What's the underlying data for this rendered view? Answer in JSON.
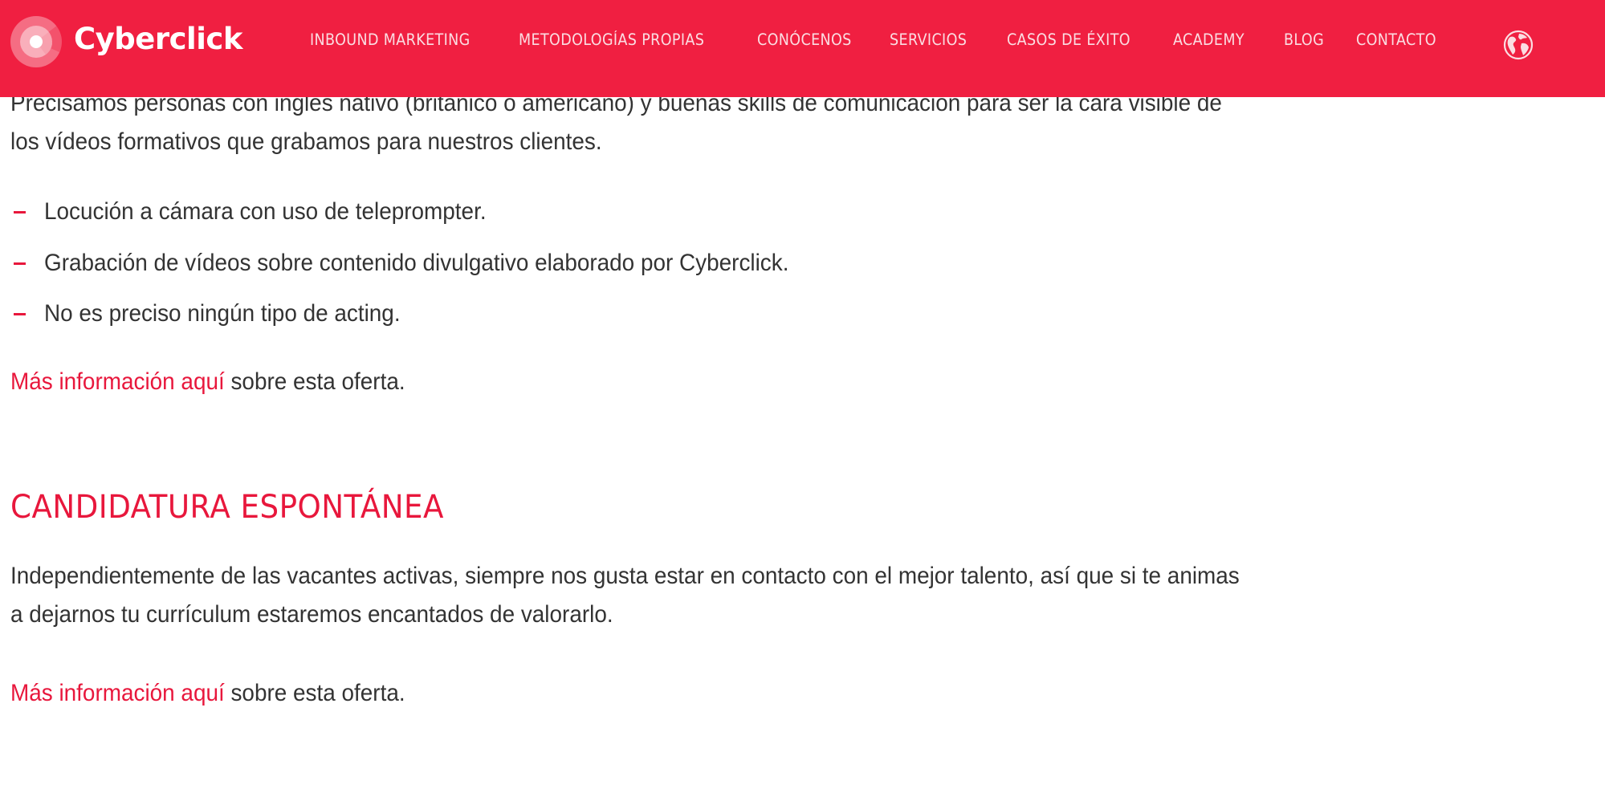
{
  "header": {
    "brand": "Cyberclick",
    "nav": [
      {
        "label": "INBOUND MARKETING"
      },
      {
        "label": "METODOLOGÍAS PROPIAS"
      },
      {
        "label": "CONÓCENOS"
      },
      {
        "label": "SERVICIOS"
      },
      {
        "label": "CASOS DE ÉXITO"
      },
      {
        "label": "ACADEMY"
      },
      {
        "label": "BLOG"
      },
      {
        "label": "CONTACTO"
      }
    ],
    "language_icon": "globe-icon"
  },
  "job_offer": {
    "description_lines": [
      "Precisamos personas con inglés nativo (británico o americano) y buenas skills de comunicación para ser la cara visible de",
      "los vídeos formativos que grabamos para nuestros clientes."
    ],
    "bullets": [
      "Locución a cámara con uso de teleprompter.",
      "Grabación de vídeos sobre contenido divulgativo elaborado por Cyberclick.",
      "No es preciso ningún tipo de acting."
    ],
    "more_info_link": "Más información aquí",
    "more_info_suffix": " sobre esta oferta."
  },
  "spontaneous": {
    "title": "CANDIDATURA ESPONTÁNEA",
    "description_lines": [
      "Independientemente de las vacantes activas, siempre nos gusta estar en contacto con el mejor talento, así que si te animas",
      "a dejarnos tu currículum estaremos encantados de valorarlo."
    ],
    "more_info_link": "Más información aquí",
    "more_info_suffix": " sobre esta oferta."
  },
  "colors": {
    "brand_red": "#f01f41",
    "link_red": "#e8173c",
    "text": "#333333"
  }
}
